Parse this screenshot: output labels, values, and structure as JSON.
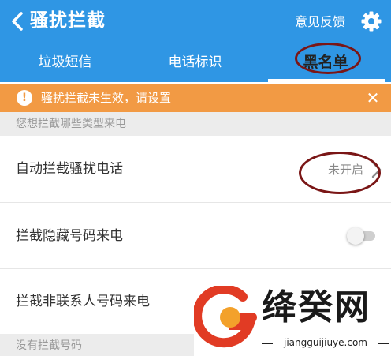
{
  "header": {
    "title": "骚扰拦截",
    "feedback_label": "意见反馈",
    "back_icon": "chevron-left-icon",
    "settings_icon": "gear-icon"
  },
  "tabs": [
    {
      "label": "垃圾短信",
      "active": false
    },
    {
      "label": "电话标识",
      "active": false
    },
    {
      "label": "黑名单",
      "active": true
    }
  ],
  "banner": {
    "text": "骚扰拦截未生效，请设置",
    "icon": "exclamation-icon",
    "close_icon": "close-icon"
  },
  "sections": {
    "call_types_header": "您想拦截哪些类型来电",
    "blocked_numbers_header": "没有拦截号码"
  },
  "rows": [
    {
      "label": "自动拦截骚扰电话",
      "status": "未开启",
      "control": "chevron"
    },
    {
      "label": "拦截隐藏号码来电",
      "control": "toggle",
      "enabled": false
    },
    {
      "label": "拦截非联系人号码来电"
    }
  ],
  "watermark": {
    "brand": "绛癸网",
    "url": "jiangguijiuye.com"
  },
  "colors": {
    "header_bg": "#2f96e4",
    "banner_bg": "#f29a44",
    "section_bg": "#ececec",
    "annotation_circle": "#7a1616"
  }
}
